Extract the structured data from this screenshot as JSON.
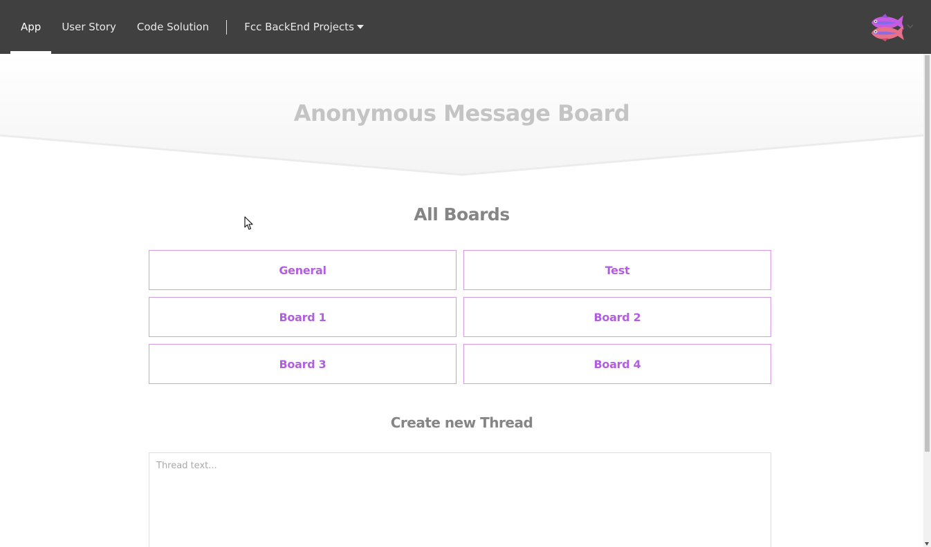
{
  "navbar": {
    "links": [
      {
        "label": "App"
      },
      {
        "label": "User Story"
      },
      {
        "label": "Code Solution"
      }
    ],
    "dropdown_label": "Fcc BackEnd Projects",
    "avatar_icon": "fish-logo-icon"
  },
  "header": {
    "title": "Anonymous Message Board"
  },
  "boards_section": {
    "heading": "All Boards",
    "boards": [
      {
        "label": "General"
      },
      {
        "label": "Test"
      },
      {
        "label": "Board 1"
      },
      {
        "label": "Board 2"
      },
      {
        "label": "Board 3"
      },
      {
        "label": "Board 4"
      }
    ]
  },
  "thread_form": {
    "heading": "Create new Thread",
    "text_placeholder": "Thread text..."
  },
  "colors": {
    "navbar_bg": "#404040",
    "accent": "#b35ee0",
    "board_border": "#d59be9",
    "title": "#c4c4c4",
    "heading": "#858585"
  }
}
